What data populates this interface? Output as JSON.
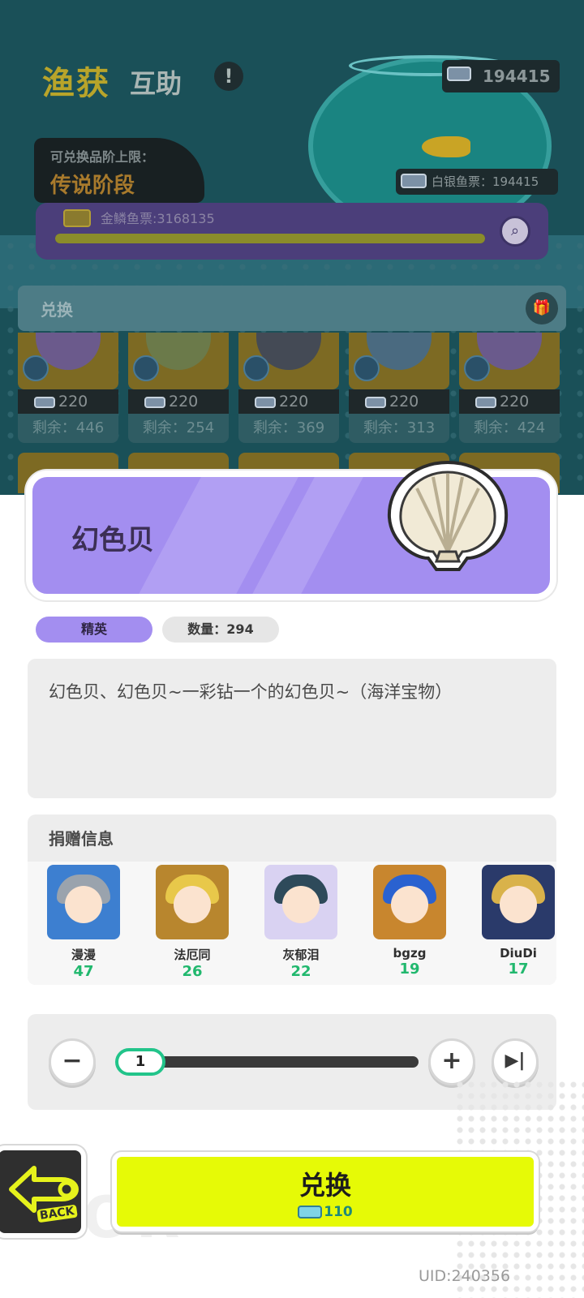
{
  "background": {
    "title_main": "渔获",
    "title_sub": "互助",
    "title_hint": "!",
    "top_ticket_count": "194415",
    "rank_label": "可兑换品阶上限：",
    "rank_value": "传说阶段",
    "silver_label": "白银鱼票：194415",
    "gold_label": "金鳞鱼票:3168135",
    "gold_progress": 1.0,
    "exchange_label": "兑换",
    "items": [
      {
        "price": "220",
        "remain": "剩余：446",
        "color": "#6b5a8c"
      },
      {
        "price": "220",
        "remain": "剩余：254",
        "color": "#6b7a4a"
      },
      {
        "price": "220",
        "remain": "剩余：369",
        "color": "#444a55"
      },
      {
        "price": "220",
        "remain": "剩余：313",
        "color": "#4a6a80"
      },
      {
        "price": "220",
        "remain": "剩余：424",
        "color": "#6a5a8c"
      }
    ]
  },
  "item": {
    "name": "幻色贝",
    "rank": "精英",
    "quantity": "数量：294",
    "description": "幻色贝、幻色贝~一彩钻一个的幻色贝~（海洋宝物）",
    "icon": "shell-icon"
  },
  "donors": {
    "title": "捐赠信息",
    "list": [
      {
        "name": "漫漫",
        "count": "47",
        "frame": "#3d7fd0",
        "hair": "#9aa3ad"
      },
      {
        "name": "法厄同",
        "count": "26",
        "frame": "#b8862e",
        "hair": "#e8c84a"
      },
      {
        "name": "灰郁泪",
        "count": "22",
        "frame": "#d9d2f2",
        "hair": "#2e4a5a"
      },
      {
        "name": "bgzg",
        "count": "19",
        "frame": "#c8862e",
        "hair": "#2a62d0"
      },
      {
        "name": "DiuDi",
        "count": "17",
        "frame": "#2a3a6a",
        "hair": "#d9b24a"
      }
    ]
  },
  "stepper": {
    "value": "1",
    "minus": "−",
    "plus": "+",
    "max": "▶|"
  },
  "actions": {
    "back_label": "BACK",
    "confirm_label": "兑换",
    "confirm_cost": "110"
  },
  "footer": {
    "uid": "UID:240356"
  },
  "colors": {
    "accent_purple": "#a38ef0",
    "confirm_yellow": "#e6fa06",
    "count_green": "#21b86e",
    "slider_green": "#22c48a"
  }
}
